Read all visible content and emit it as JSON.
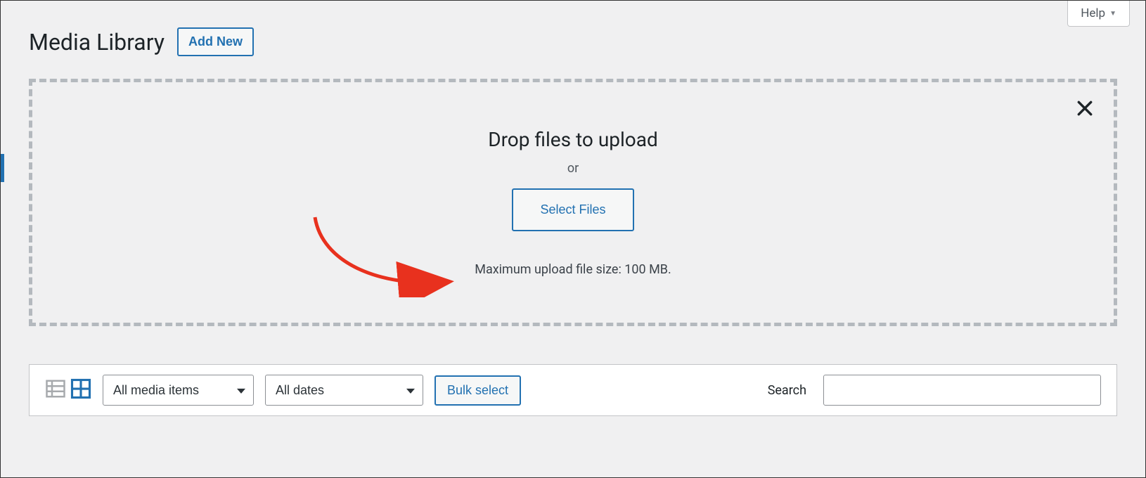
{
  "help": {
    "label": "Help"
  },
  "header": {
    "title": "Media Library",
    "add_new_label": "Add New"
  },
  "dropzone": {
    "heading": "Drop files to upload",
    "or": "or",
    "select_files_label": "Select Files",
    "max_size_text": "Maximum upload file size: 100 MB."
  },
  "toolbar": {
    "filter_media_selected": "All media items",
    "filter_dates_selected": "All dates",
    "bulk_select_label": "Bulk select",
    "search_label": "Search",
    "search_value": ""
  },
  "icons": {
    "list_view": "list-view-icon",
    "grid_view": "grid-view-icon",
    "close": "close-icon",
    "help_caret": "caret-down-icon"
  }
}
